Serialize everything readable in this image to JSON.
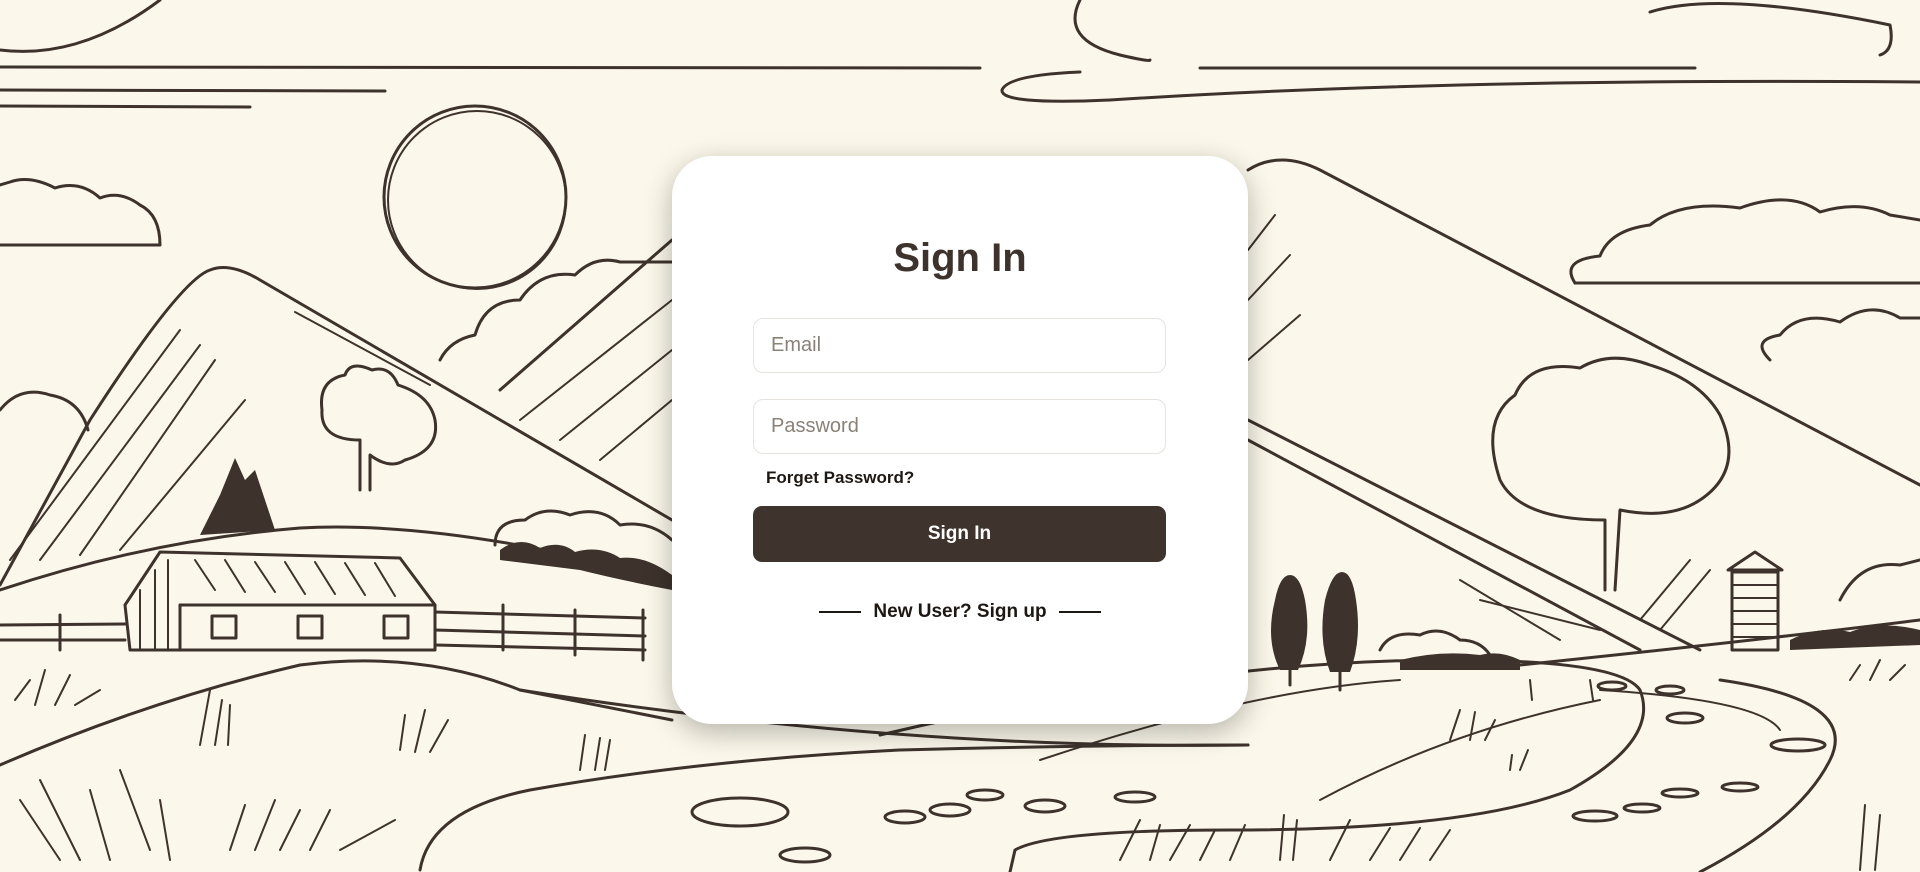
{
  "signin": {
    "title": "Sign In",
    "email_placeholder": "Email",
    "password_placeholder": "Password",
    "forgot_label": "Forget Password?",
    "submit_label": "Sign In",
    "new_user_label": "New User? Sign up"
  },
  "colors": {
    "background": "#fbf7ea",
    "ink": "#3d332c",
    "card": "#ffffff",
    "button": "#3e342d"
  }
}
